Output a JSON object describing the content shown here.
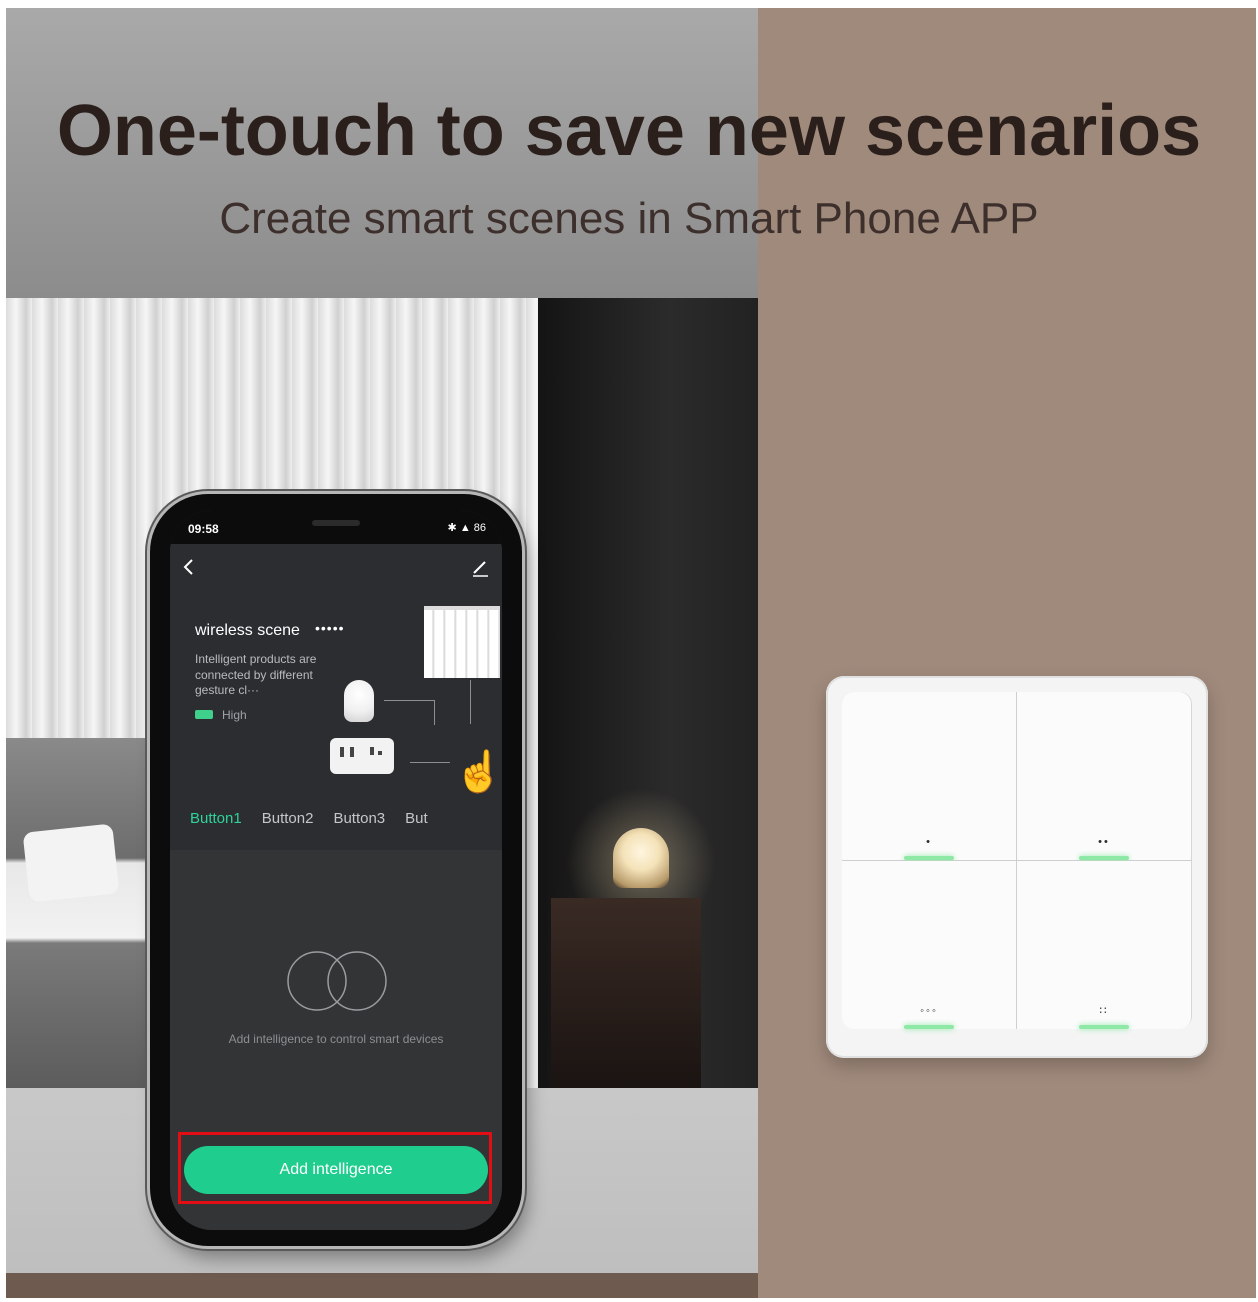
{
  "headline": "One-touch to save new scenarios",
  "subline": "Create smart scenes in Smart Phone APP",
  "phone": {
    "status_time": "09:58",
    "status_icons": "✱ ▲ 86",
    "back_icon": "chevron-left-icon",
    "edit_icon": "pencil-icon",
    "scene_title": "wireless scene",
    "scene_dots": "•••••",
    "scene_description": "Intelligent products are connected by different gesture cl···",
    "battery_label": "High",
    "tabs": [
      "Button1",
      "Button2",
      "Button3",
      "But"
    ],
    "active_tab_index": 0,
    "empty_state_text": "Add intelligence to control smart devices",
    "add_button_label": "Add intelligence"
  },
  "switch": {
    "keys": [
      {
        "mark": "•"
      },
      {
        "mark": "••"
      },
      {
        "mark": "◦◦◦"
      },
      {
        "mark": "∷"
      }
    ]
  },
  "colors": {
    "accent_green": "#1fce8e",
    "highlight_red": "#e30d16",
    "tab_active": "#2fd39a",
    "background_brown": "#a08a7c"
  }
}
